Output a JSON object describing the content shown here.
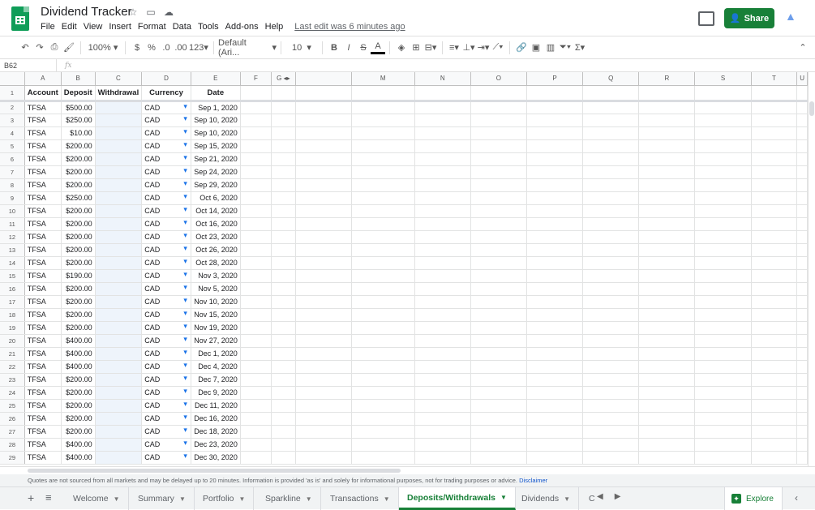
{
  "app": {
    "doc_title": "Dividend Tracker",
    "menu": [
      "File",
      "Edit",
      "View",
      "Insert",
      "Format",
      "Data",
      "Tools",
      "Add-ons",
      "Help"
    ],
    "last_edit": "Last edit was 6 minutes ago",
    "share_label": "Share"
  },
  "toolbar": {
    "zoom": "100%",
    "currency": "$",
    "percent": "%",
    "dec_less": ".0",
    "dec_more": ".00",
    "format_more": "123",
    "font": "Default (Ari...",
    "font_size": "10",
    "bold": "B",
    "italic": "I",
    "strike": "S",
    "text_color": "A",
    "sigma": "Σ"
  },
  "formula_bar": {
    "cell_ref": "B62",
    "fx": "fx",
    "content": ""
  },
  "columns": [
    "A",
    "B",
    "C",
    "D",
    "E",
    "F",
    "G",
    "M",
    "N",
    "O",
    "P",
    "Q",
    "R",
    "S",
    "T",
    "U"
  ],
  "header_row": {
    "row_num": "1",
    "cells": [
      "Account",
      "Deposit",
      "Withdrawal",
      "Currency",
      "Date"
    ]
  },
  "rows": [
    {
      "n": "2",
      "account": "TFSA",
      "deposit": "$500.00",
      "withdrawal": "",
      "currency": "CAD",
      "date": "Sep 1, 2020"
    },
    {
      "n": "3",
      "account": "TFSA",
      "deposit": "$250.00",
      "withdrawal": "",
      "currency": "CAD",
      "date": "Sep 10, 2020"
    },
    {
      "n": "4",
      "account": "TFSA",
      "deposit": "$10.00",
      "withdrawal": "",
      "currency": "CAD",
      "date": "Sep 10, 2020"
    },
    {
      "n": "5",
      "account": "TFSA",
      "deposit": "$200.00",
      "withdrawal": "",
      "currency": "CAD",
      "date": "Sep 15, 2020"
    },
    {
      "n": "6",
      "account": "TFSA",
      "deposit": "$200.00",
      "withdrawal": "",
      "currency": "CAD",
      "date": "Sep 21, 2020"
    },
    {
      "n": "7",
      "account": "TFSA",
      "deposit": "$200.00",
      "withdrawal": "",
      "currency": "CAD",
      "date": "Sep 24, 2020"
    },
    {
      "n": "8",
      "account": "TFSA",
      "deposit": "$200.00",
      "withdrawal": "",
      "currency": "CAD",
      "date": "Sep 29, 2020"
    },
    {
      "n": "9",
      "account": "TFSA",
      "deposit": "$250.00",
      "withdrawal": "",
      "currency": "CAD",
      "date": "Oct 6, 2020"
    },
    {
      "n": "10",
      "account": "TFSA",
      "deposit": "$200.00",
      "withdrawal": "",
      "currency": "CAD",
      "date": "Oct 14, 2020"
    },
    {
      "n": "11",
      "account": "TFSA",
      "deposit": "$200.00",
      "withdrawal": "",
      "currency": "CAD",
      "date": "Oct 16, 2020"
    },
    {
      "n": "12",
      "account": "TFSA",
      "deposit": "$200.00",
      "withdrawal": "",
      "currency": "CAD",
      "date": "Oct 23, 2020"
    },
    {
      "n": "13",
      "account": "TFSA",
      "deposit": "$200.00",
      "withdrawal": "",
      "currency": "CAD",
      "date": "Oct 26, 2020"
    },
    {
      "n": "14",
      "account": "TFSA",
      "deposit": "$200.00",
      "withdrawal": "",
      "currency": "CAD",
      "date": "Oct 28, 2020"
    },
    {
      "n": "15",
      "account": "TFSA",
      "deposit": "$190.00",
      "withdrawal": "",
      "currency": "CAD",
      "date": "Nov 3, 2020"
    },
    {
      "n": "16",
      "account": "TFSA",
      "deposit": "$200.00",
      "withdrawal": "",
      "currency": "CAD",
      "date": "Nov 5, 2020"
    },
    {
      "n": "17",
      "account": "TFSA",
      "deposit": "$200.00",
      "withdrawal": "",
      "currency": "CAD",
      "date": "Nov 10, 2020"
    },
    {
      "n": "18",
      "account": "TFSA",
      "deposit": "$200.00",
      "withdrawal": "",
      "currency": "CAD",
      "date": "Nov 15, 2020"
    },
    {
      "n": "19",
      "account": "TFSA",
      "deposit": "$200.00",
      "withdrawal": "",
      "currency": "CAD",
      "date": "Nov 19, 2020"
    },
    {
      "n": "20",
      "account": "TFSA",
      "deposit": "$400.00",
      "withdrawal": "",
      "currency": "CAD",
      "date": "Nov 27, 2020"
    },
    {
      "n": "21",
      "account": "TFSA",
      "deposit": "$400.00",
      "withdrawal": "",
      "currency": "CAD",
      "date": "Dec 1, 2020"
    },
    {
      "n": "22",
      "account": "TFSA",
      "deposit": "$400.00",
      "withdrawal": "",
      "currency": "CAD",
      "date": "Dec 4, 2020"
    },
    {
      "n": "23",
      "account": "TFSA",
      "deposit": "$200.00",
      "withdrawal": "",
      "currency": "CAD",
      "date": "Dec 7, 2020"
    },
    {
      "n": "24",
      "account": "TFSA",
      "deposit": "$200.00",
      "withdrawal": "",
      "currency": "CAD",
      "date": "Dec 9, 2020"
    },
    {
      "n": "25",
      "account": "TFSA",
      "deposit": "$200.00",
      "withdrawal": "",
      "currency": "CAD",
      "date": "Dec 11, 2020"
    },
    {
      "n": "26",
      "account": "TFSA",
      "deposit": "$200.00",
      "withdrawal": "",
      "currency": "CAD",
      "date": "Dec 16, 2020"
    },
    {
      "n": "27",
      "account": "TFSA",
      "deposit": "$200.00",
      "withdrawal": "",
      "currency": "CAD",
      "date": "Dec 18, 2020"
    },
    {
      "n": "28",
      "account": "TFSA",
      "deposit": "$400.00",
      "withdrawal": "",
      "currency": "CAD",
      "date": "Dec 23, 2020"
    },
    {
      "n": "29",
      "account": "TFSA",
      "deposit": "$400.00",
      "withdrawal": "",
      "currency": "CAD",
      "date": "Dec 30, 2020"
    }
  ],
  "disclaimer": {
    "text": "Quotes are not sourced from all markets and may be delayed up to 20 minutes. Information is provided 'as is' and solely for informational purposes, not for trading purposes or advice.",
    "link": "Disclaimer"
  },
  "sheet_tabs": [
    {
      "label": "Welcome",
      "active": false
    },
    {
      "label": "Summary",
      "active": false
    },
    {
      "label": "Portfolio",
      "active": false
    },
    {
      "label": "Sparkline",
      "active": false
    },
    {
      "label": "Transactions",
      "active": false
    },
    {
      "label": "Deposits/Withdrawals",
      "active": true
    },
    {
      "label": "Dividends",
      "active": false
    },
    {
      "label": "C",
      "active": false
    }
  ],
  "explore_label": "Explore",
  "colors": {
    "accent": "#188038",
    "selected_col": "#e8eaed",
    "link": "#1155cc"
  }
}
